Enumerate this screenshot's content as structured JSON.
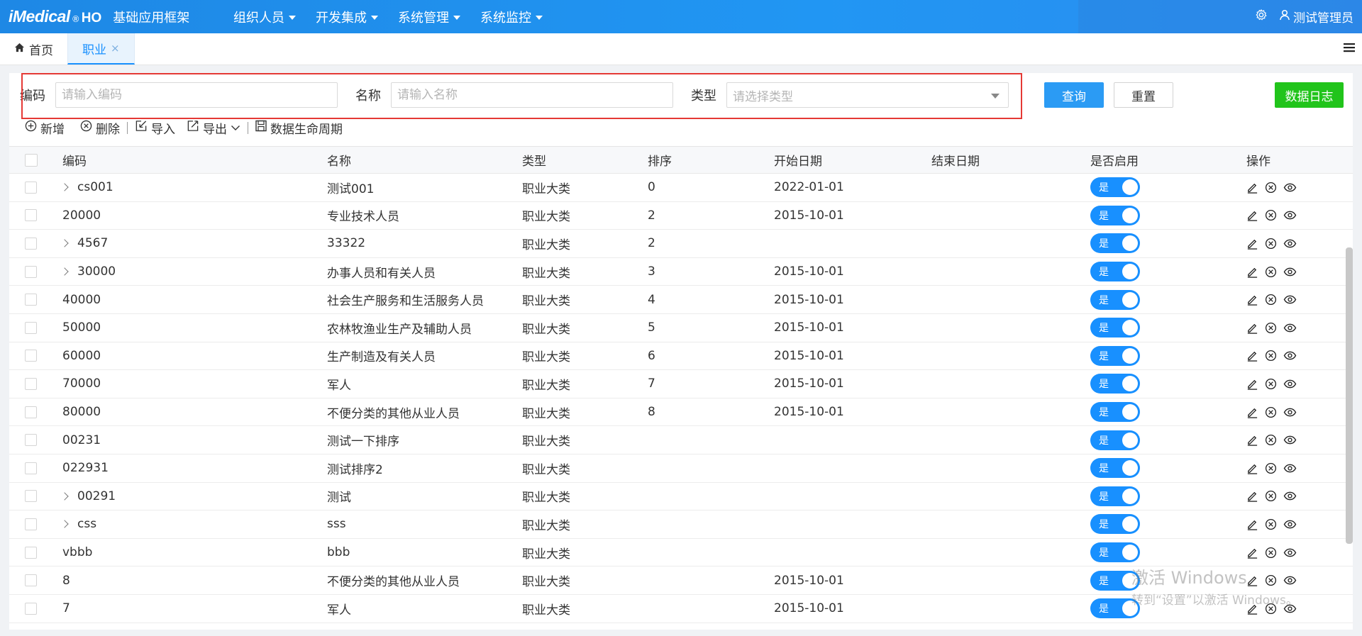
{
  "header": {
    "brand": "iMedical",
    "reg": "®",
    "ho": "HO",
    "app_name": "基础应用框架",
    "nav": [
      "组织人员",
      "开发集成",
      "系统管理",
      "系统监控"
    ],
    "user": "测试管理员"
  },
  "tabs": {
    "home": "首页",
    "active": "职业",
    "close": "×"
  },
  "search": {
    "code_label": "编码",
    "code_placeholder": "请输入编码",
    "name_label": "名称",
    "name_placeholder": "请输入名称",
    "type_label": "类型",
    "type_placeholder": "请选择类型",
    "query": "查询",
    "reset": "重置",
    "log": "数据日志"
  },
  "toolbar": {
    "add": "新增",
    "delete": "删除",
    "import": "导入",
    "export": "导出",
    "lifecycle": "数据生命周期"
  },
  "table": {
    "columns": [
      "编码",
      "名称",
      "类型",
      "排序",
      "开始日期",
      "结束日期",
      "是否启用",
      "操作"
    ],
    "rows": [
      {
        "code": "cs001",
        "expand": true,
        "name": "测试001",
        "type": "职业大类",
        "sort": "0",
        "start": "2022-01-01",
        "end": "",
        "enabled": "是"
      },
      {
        "code": "20000",
        "expand": false,
        "name": "专业技术人员",
        "type": "职业大类",
        "sort": "2",
        "start": "2015-10-01",
        "end": "",
        "enabled": "是"
      },
      {
        "code": "4567",
        "expand": true,
        "name": "33322",
        "type": "职业大类",
        "sort": "2",
        "start": "",
        "end": "",
        "enabled": "是"
      },
      {
        "code": "30000",
        "expand": true,
        "name": "办事人员和有关人员",
        "type": "职业大类",
        "sort": "3",
        "start": "2015-10-01",
        "end": "",
        "enabled": "是"
      },
      {
        "code": "40000",
        "expand": false,
        "name": "社会生产服务和生活服务人员",
        "type": "职业大类",
        "sort": "4",
        "start": "2015-10-01",
        "end": "",
        "enabled": "是"
      },
      {
        "code": "50000",
        "expand": false,
        "name": "农林牧渔业生产及辅助人员",
        "type": "职业大类",
        "sort": "5",
        "start": "2015-10-01",
        "end": "",
        "enabled": "是"
      },
      {
        "code": "60000",
        "expand": false,
        "name": "生产制造及有关人员",
        "type": "职业大类",
        "sort": "6",
        "start": "2015-10-01",
        "end": "",
        "enabled": "是"
      },
      {
        "code": "70000",
        "expand": false,
        "name": "军人",
        "type": "职业大类",
        "sort": "7",
        "start": "2015-10-01",
        "end": "",
        "enabled": "是"
      },
      {
        "code": "80000",
        "expand": false,
        "name": "不便分类的其他从业人员",
        "type": "职业大类",
        "sort": "8",
        "start": "2015-10-01",
        "end": "",
        "enabled": "是"
      },
      {
        "code": "00231",
        "expand": false,
        "name": "测试一下排序",
        "type": "职业大类",
        "sort": "",
        "start": "",
        "end": "",
        "enabled": "是"
      },
      {
        "code": "022931",
        "expand": false,
        "name": "测试排序2",
        "type": "职业大类",
        "sort": "",
        "start": "",
        "end": "",
        "enabled": "是"
      },
      {
        "code": "00291",
        "expand": true,
        "name": "测试",
        "type": "职业大类",
        "sort": "",
        "start": "",
        "end": "",
        "enabled": "是"
      },
      {
        "code": "css",
        "expand": true,
        "name": "sss",
        "type": "职业大类",
        "sort": "",
        "start": "",
        "end": "",
        "enabled": "是"
      },
      {
        "code": "vbbb",
        "expand": false,
        "name": "bbb",
        "type": "职业大类",
        "sort": "",
        "start": "",
        "end": "",
        "enabled": "是"
      },
      {
        "code": "8",
        "expand": false,
        "name": "不便分类的其他从业人员",
        "type": "职业大类",
        "sort": "",
        "start": "2015-10-01",
        "end": "",
        "enabled": "是"
      },
      {
        "code": "7",
        "expand": false,
        "name": "军人",
        "type": "职业大类",
        "sort": "",
        "start": "2015-10-01",
        "end": "",
        "enabled": "是"
      }
    ]
  },
  "watermark": {
    "line1": "激活 Windows",
    "line2": "转到“设置”以激活 Windows。"
  },
  "colors": {
    "topbar": "#2196f3",
    "primary": "#1890ff",
    "success": "#21c41b",
    "highlight": "#e53935"
  }
}
